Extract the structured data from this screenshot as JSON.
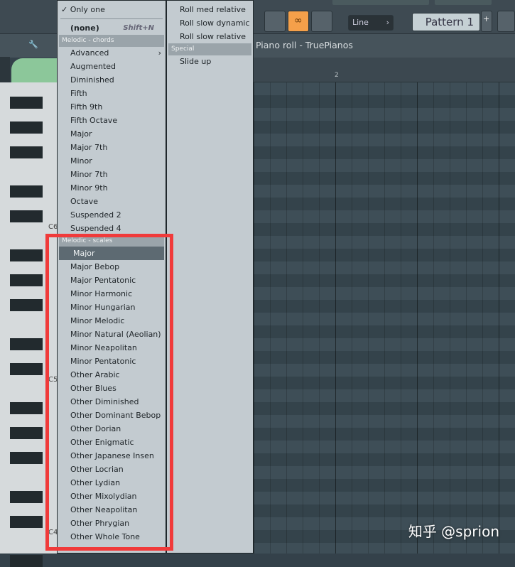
{
  "toolbar": {
    "snap_mode": "Line",
    "pattern": "Pattern 1",
    "plus": "+"
  },
  "piano_roll": {
    "title": "Piano roll - TruePianos",
    "ruler_bar": "2",
    "key_labels": [
      "C6",
      "C5",
      "C4"
    ]
  },
  "menu_left": {
    "only_one": "✓ Only one",
    "none": "(none)",
    "none_shortcut": "Shift+N",
    "chords_header": "Melodic - chords",
    "chords": [
      "Advanced",
      "Augmented",
      "Diminished",
      "Fifth",
      "Fifth 9th",
      "Fifth Octave",
      "Major",
      "Major 7th",
      "Minor",
      "Minor 7th",
      "Minor 9th",
      "Octave",
      "Suspended 2",
      "Suspended 4"
    ],
    "scales_header": "Melodic - scales",
    "scales": [
      "Major",
      "Major Bebop",
      "Major Pentatonic",
      "Minor Harmonic",
      "Minor Hungarian",
      "Minor Melodic",
      "Minor Natural (Aeolian)",
      "Minor Neapolitan",
      "Minor Pentatonic",
      "Other Arabic",
      "Other Blues",
      "Other Diminished",
      "Other Dominant Bebop",
      "Other Dorian",
      "Other Enigmatic",
      "Other Japanese Insen",
      "Other Locrian",
      "Other Lydian",
      "Other Mixolydian",
      "Other Neapolitan",
      "Other Phrygian",
      "Other Whole Tone"
    ],
    "selected": "Major"
  },
  "menu_right": {
    "items": [
      "Roll med relative",
      "Roll slow dynamic",
      "Roll slow relative"
    ],
    "special_header": "Special",
    "special": [
      "Slide up"
    ]
  },
  "watermark": "知乎 @sprion",
  "colors": {
    "highlight": "#f03a3a",
    "link_button": "#f5a04a"
  }
}
